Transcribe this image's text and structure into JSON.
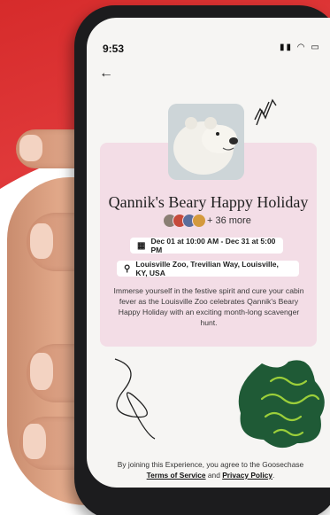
{
  "status_bar": {
    "time": "9:53"
  },
  "event": {
    "title": "Qannik's Beary Happy Holiday",
    "participants_more": "+ 36 more",
    "date_range": "Dec 01 at 10:00 AM - Dec 31 at 5:00 PM",
    "location": "Louisville Zoo, Trevilian Way, Louisville, KY, USA",
    "description": "Immerse yourself in the festive spirit and cure your cabin fever as the Louisville Zoo celebrates Qannik's Beary Happy Holiday with an exciting month-long scavenger hunt."
  },
  "footer": {
    "text_prefix": "By joining this Experience, you agree to the Goosechase",
    "terms_label": "Terms of Service",
    "and_text": "and",
    "privacy_label": "Privacy Policy",
    "period": "."
  },
  "colors": {
    "background_red": "#d62b2b",
    "card_pink": "#f3dde6",
    "phone_body": "#1c1c1e",
    "blob_green": "#1f5a36"
  },
  "icons": {
    "back": "back-arrow-icon",
    "calendar": "calendar-icon",
    "location": "location-pin-icon"
  }
}
